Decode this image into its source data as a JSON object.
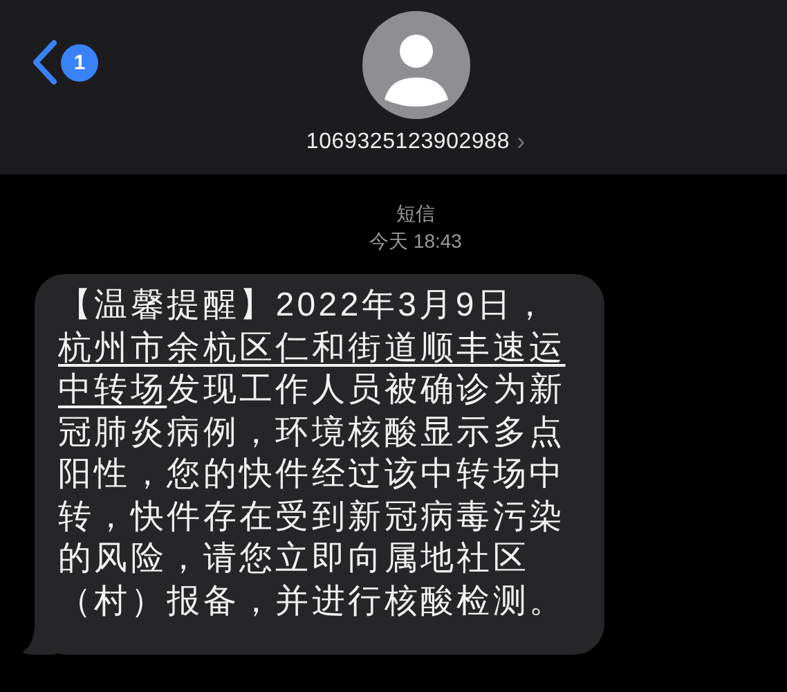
{
  "header": {
    "back_badge": "1",
    "contact": "1069325123902988",
    "chevron": "›"
  },
  "thread": {
    "service": "短信",
    "timestamp": "今天 18:43"
  },
  "message": {
    "lines": [
      [
        {
          "text": "【温馨提醒】2022年3月9日，",
          "link": false
        }
      ],
      [
        {
          "text": "杭州市余杭区仁和街道顺丰速运",
          "link": true
        }
      ],
      [
        {
          "text": "中转场",
          "link": true
        },
        {
          "text": "发现工作人员被确诊为新",
          "link": false
        }
      ],
      [
        {
          "text": "冠肺炎病例，环境核酸显示多点",
          "link": false
        }
      ],
      [
        {
          "text": "阳性，您的快件经过该中转场中",
          "link": false
        }
      ],
      [
        {
          "text": "转，快件存在受到新冠病毒污染",
          "link": false
        }
      ],
      [
        {
          "text": "的风险，请您立即向属地社区",
          "link": false
        }
      ],
      [
        {
          "text": "（村）报备，并进行核酸检测。",
          "link": false
        }
      ]
    ]
  }
}
